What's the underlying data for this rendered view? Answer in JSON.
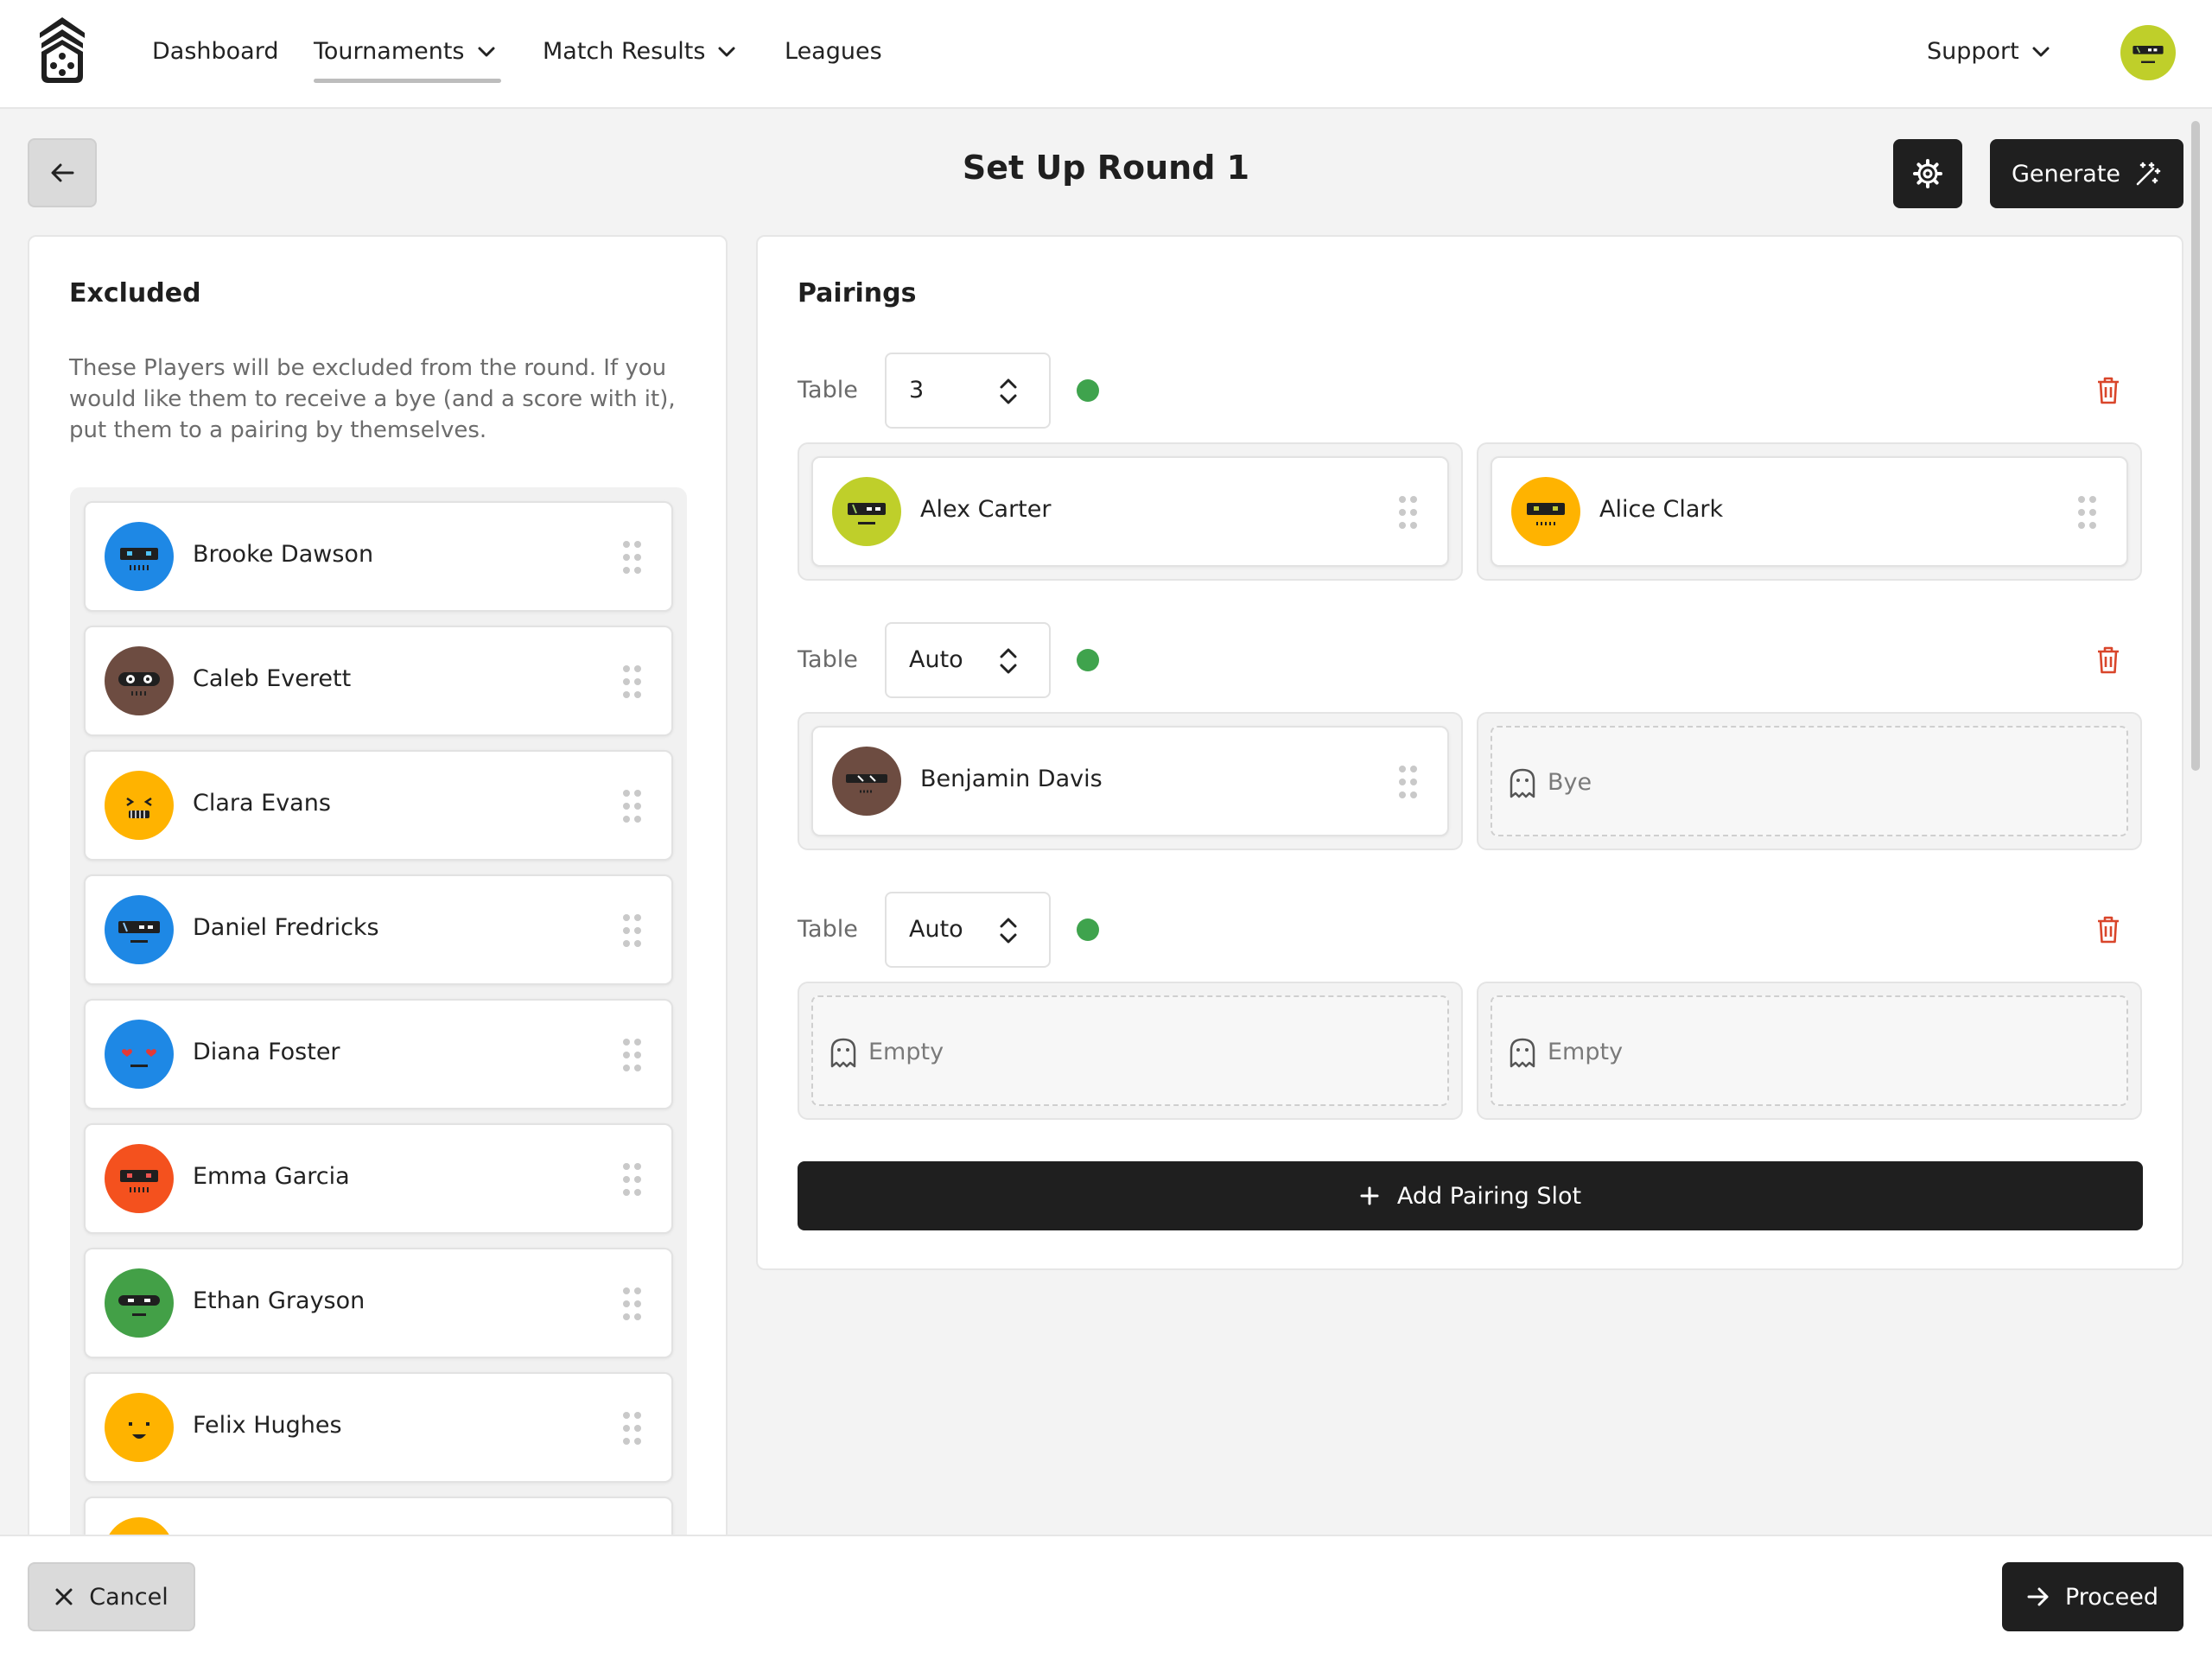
{
  "colors": {
    "accent": "#1f1f1f",
    "status_dot": "#3fa34d",
    "delete": "#d9462b"
  },
  "nav": {
    "items": [
      {
        "label": "Dashboard"
      },
      {
        "label": "Tournaments",
        "dropdown": true,
        "active": true
      },
      {
        "label": "Match Results",
        "dropdown": true
      },
      {
        "label": "Leagues"
      }
    ],
    "support_label": "Support"
  },
  "page": {
    "title": "Set Up Round 1",
    "generate_label": "Generate"
  },
  "excluded": {
    "title": "Excluded",
    "description": "These Players will be excluded from the round. If you would like them to receive a bye (and a score with it), put them to a pairing by themselves.",
    "players": [
      {
        "name": "Brooke Dawson",
        "color": "#1e88e5"
      },
      {
        "name": "Caleb Everett",
        "color": "#6d4c41"
      },
      {
        "name": "Clara Evans",
        "color": "#ffb300"
      },
      {
        "name": "Daniel Fredricks",
        "color": "#1e88e5"
      },
      {
        "name": "Diana Foster",
        "color": "#1e88e5"
      },
      {
        "name": "Emma Garcia",
        "color": "#f4511e"
      },
      {
        "name": "Ethan Grayson",
        "color": "#43a047"
      },
      {
        "name": "Felix Hughes",
        "color": "#ffb300"
      },
      {
        "name": "",
        "color": "#ffb300"
      }
    ]
  },
  "pairings": {
    "title": "Pairings",
    "table_label": "Table",
    "slots": [
      {
        "table": "3",
        "players": [
          {
            "name": "Alex Carter",
            "color": "#bfcf2a"
          },
          {
            "name": "Alice Clark",
            "color": "#ffb300"
          }
        ]
      },
      {
        "table": "Auto",
        "players": [
          {
            "name": "Benjamin Davis",
            "color": "#6d4c41"
          }
        ],
        "bye_label": "Bye"
      },
      {
        "table": "Auto",
        "empty_label": "Empty"
      }
    ],
    "add_label": "Add Pairing Slot"
  },
  "footer": {
    "cancel_label": "Cancel",
    "proceed_label": "Proceed"
  }
}
